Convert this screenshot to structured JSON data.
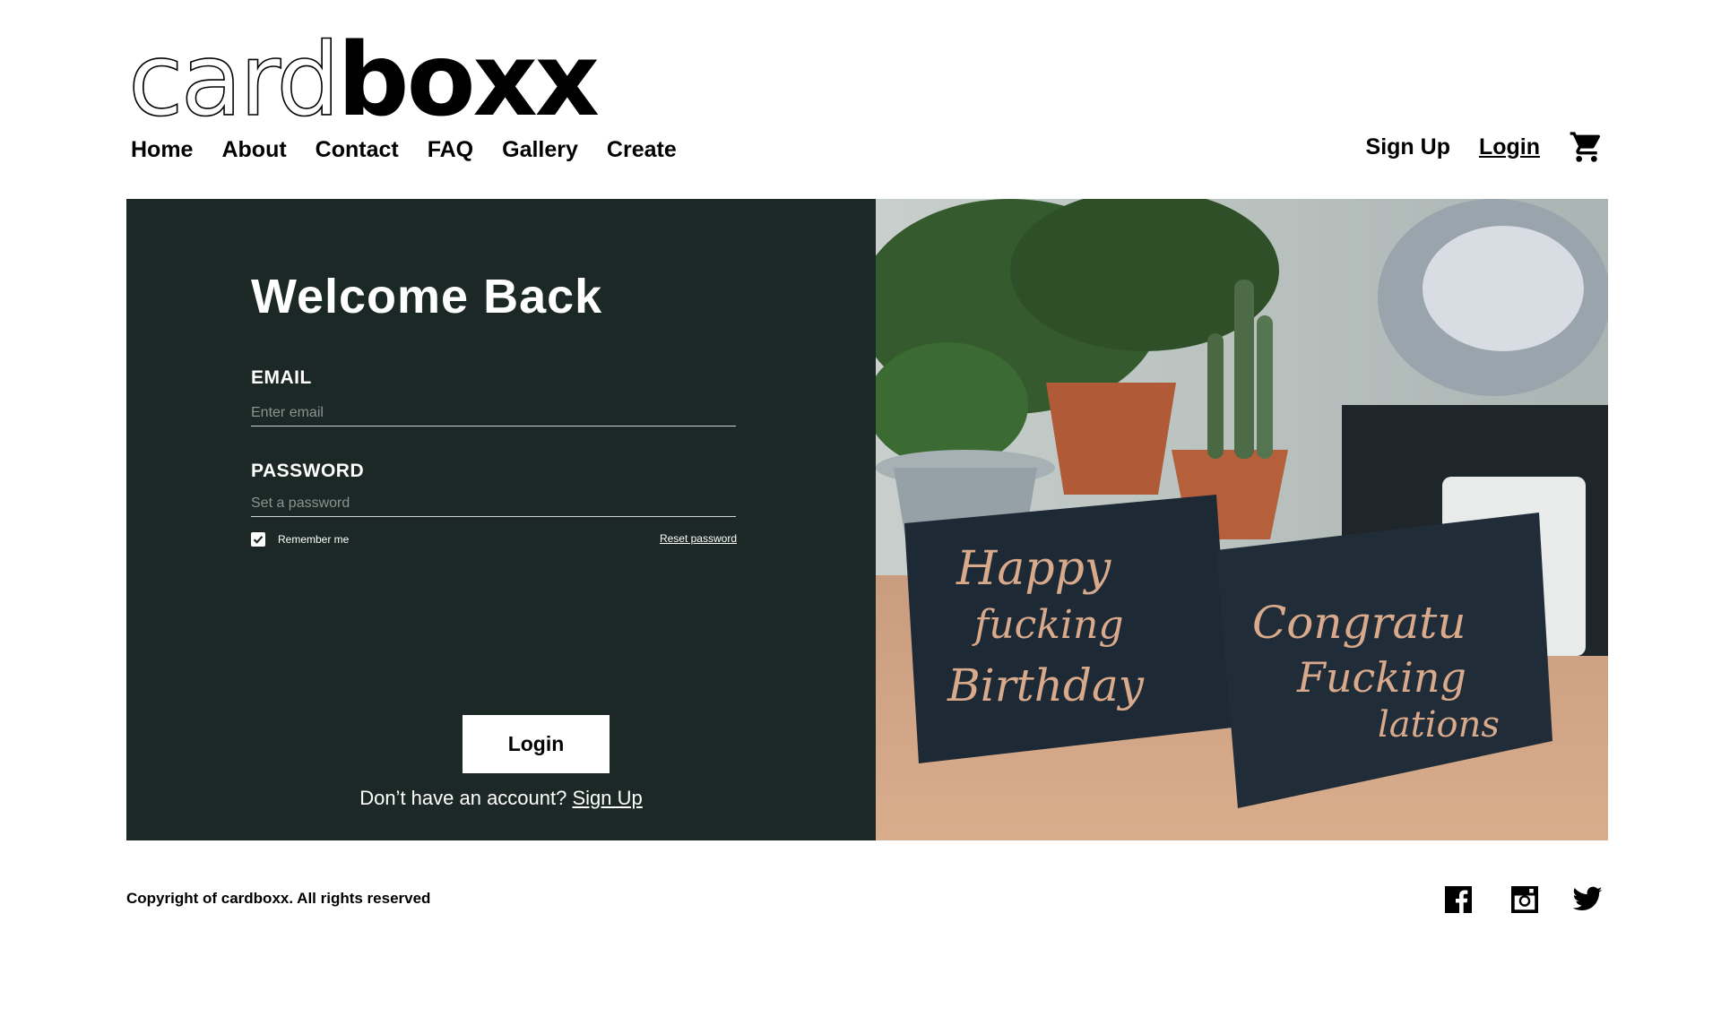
{
  "brand": {
    "logo_light": "card",
    "logo_bold": "boxx"
  },
  "nav": {
    "left": [
      "Home",
      "About",
      "Contact",
      "FAQ",
      "Gallery",
      "Create"
    ],
    "signup_label": "Sign Up",
    "login_label": "Login",
    "cart_icon": "shopping-cart-icon"
  },
  "login_panel": {
    "heading": "Welcome Back",
    "email_label": "EMAIL",
    "email_placeholder": "Enter email",
    "password_label": "PASSWORD",
    "password_placeholder": "Set a password",
    "remember_label": "Remember me",
    "remember_checked": true,
    "reset_label": "Reset password",
    "login_button": "Login",
    "no_account_text": "Don’t have an account?",
    "signup_link": "Sign Up",
    "panel_color": "#1b2825"
  },
  "hero_image": {
    "card_left_text": [
      "Happy",
      "fucking",
      "Birthday"
    ],
    "card_right_text": [
      "Congratu",
      "Fucking",
      "lations"
    ]
  },
  "footer": {
    "copyright": "Copyright of cardboxx. All rights reserved",
    "social": [
      "facebook-icon",
      "instagram-icon",
      "twitter-icon"
    ]
  }
}
